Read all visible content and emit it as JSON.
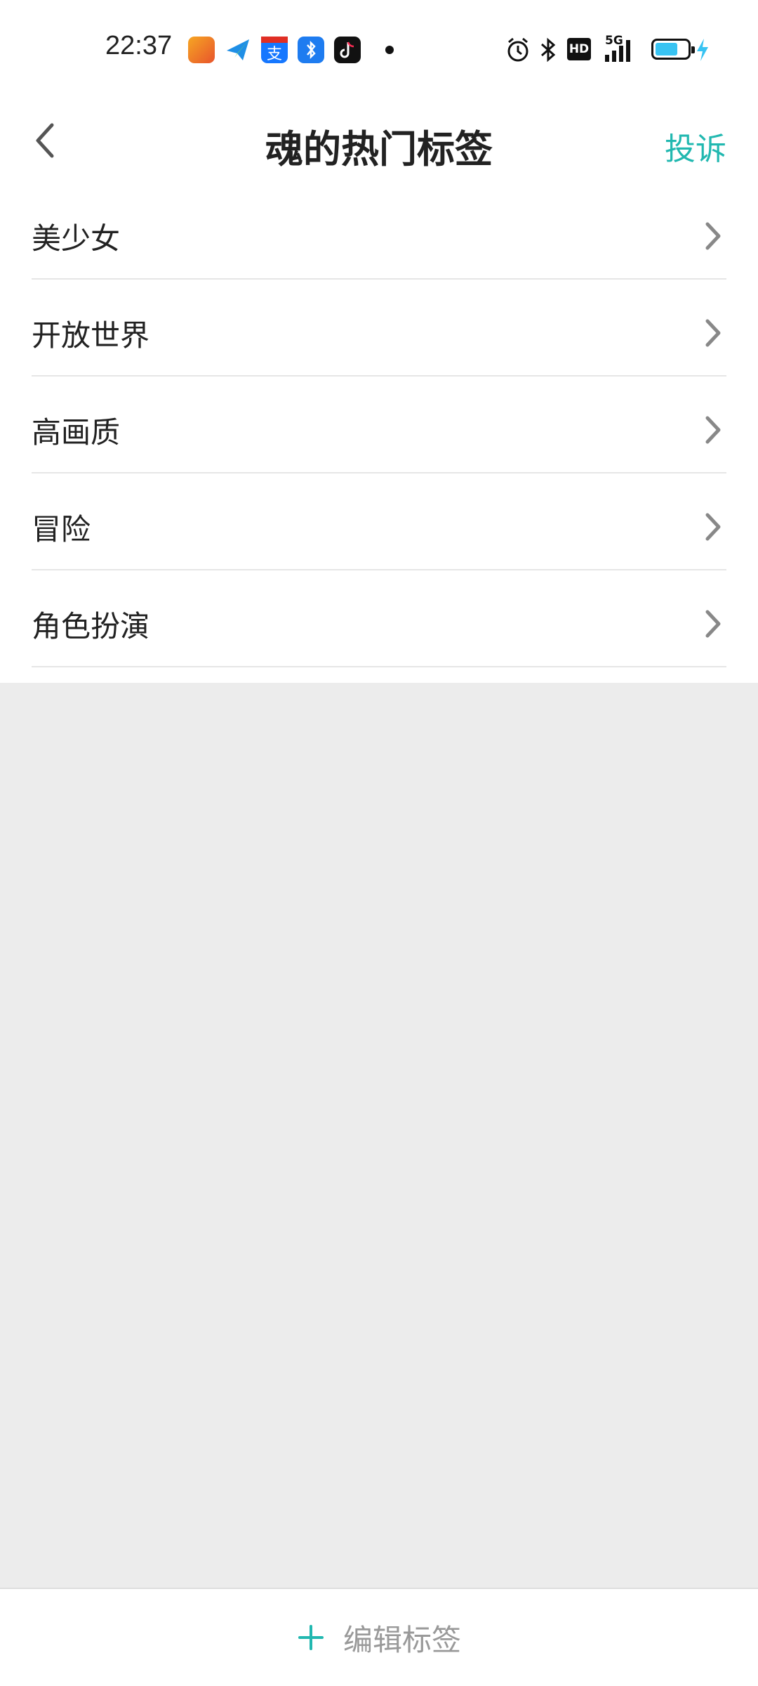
{
  "status_bar": {
    "time": "22:37",
    "notification_icons": [
      "uc-browser-icon",
      "paper-plane-icon",
      "alipay-icon",
      "bluetooth-app-icon",
      "tiktok-icon"
    ],
    "system_icons": [
      "alarm-icon",
      "bluetooth-icon",
      "hd-icon",
      "5g-signal-icon",
      "battery-icon",
      "charging-icon"
    ],
    "hd_label": "HD",
    "network_label": "5G",
    "battery_fraction": 0.7
  },
  "header": {
    "title": "魂的热门标签",
    "report_label": "投诉"
  },
  "tags": [
    {
      "label": "美少女"
    },
    {
      "label": "开放世界"
    },
    {
      "label": "高画质"
    },
    {
      "label": "冒险"
    },
    {
      "label": "角色扮演"
    }
  ],
  "bottom_bar": {
    "edit_label": "编辑标签"
  },
  "colors": {
    "accent": "#21b8b0",
    "battery_fill": "#38c3f2",
    "background": "#ececec"
  }
}
